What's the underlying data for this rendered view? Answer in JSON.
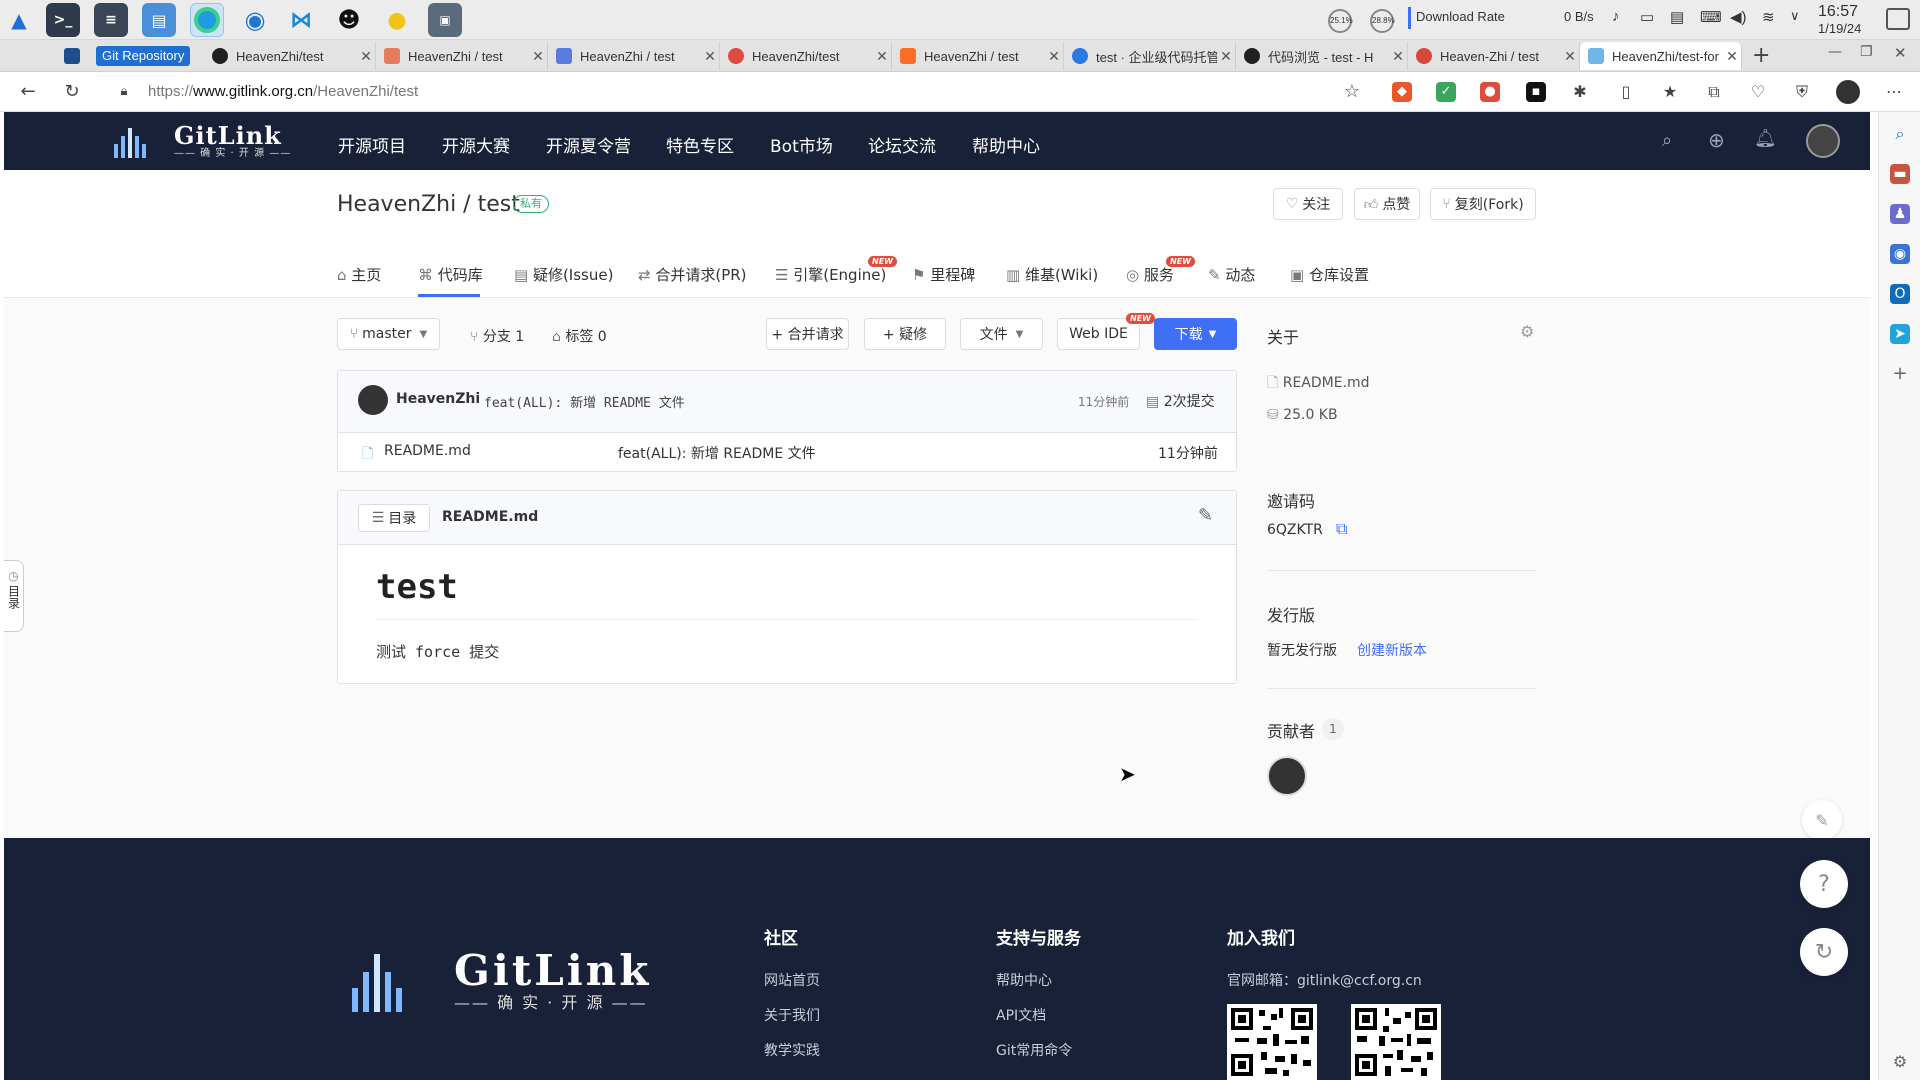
{
  "taskbar": {
    "apps": [
      "arch-logo-icon",
      "terminal-icon",
      "system-monitor-icon",
      "file-manager-icon",
      "edge-browser-icon",
      "thunderbird-icon",
      "vscode-icon",
      "qq-icon",
      "music-icon",
      "screenshot-app-icon"
    ],
    "cpu": "25.1%",
    "mem": "28.8%",
    "download_label": "Download Rate",
    "download_value": "0 B/s",
    "time": "16:57",
    "date": "1/19/24"
  },
  "browser": {
    "tabs": [
      {
        "label": "Git Repository"
      },
      {
        "label": "HeavenZhi/test"
      },
      {
        "label": "HeavenZhi / test"
      },
      {
        "label": "HeavenZhi / test"
      },
      {
        "label": "HeavenZhi/test"
      },
      {
        "label": "HeavenZhi / test"
      },
      {
        "label": "test · 企业级代码托管"
      },
      {
        "label": "代码浏览 - test - H"
      },
      {
        "label": "Heaven-Zhi / test"
      },
      {
        "label": "HeavenZhi/test-for"
      }
    ],
    "url_prefix": "https://",
    "url_host": "www.gitlink.org.cn",
    "url_path": "/HeavenZhi/test"
  },
  "site": {
    "logo_text": "GitLink",
    "logo_sub": "—— 确 实 · 开 源 ——",
    "nav": [
      "开源项目",
      "开源大赛",
      "开源夏令营",
      "特色专区",
      "Bot市场",
      "论坛交流",
      "帮助中心"
    ]
  },
  "repo": {
    "title": "HeavenZhi / test",
    "private_badge": "私有",
    "watch": "关注",
    "star": "点赞",
    "fork": "复刻(Fork)",
    "tabs": [
      "主页",
      "代码库",
      "疑修(Issue)",
      "合并请求(PR)",
      "引擎(Engine)",
      "里程碑",
      "维基(Wiki)",
      "服务",
      "动态",
      "仓库设置"
    ],
    "new_tag": "NEW",
    "branch": "master",
    "branches": "分支 1",
    "tags": "标签 0",
    "btn_pr": "+ 合并请求",
    "btn_issue": "+ 疑修",
    "btn_file": "文件",
    "btn_webide": "Web IDE",
    "btn_download": "下载"
  },
  "commit": {
    "author": "HeavenZhi",
    "message": "feat(ALL): 新增 README 文件",
    "time": "11分钟前",
    "count": "2次提交"
  },
  "files": [
    {
      "name": "README.md",
      "message": "feat(ALL): 新增 README 文件",
      "time": "11分钟前"
    }
  ],
  "readme": {
    "toc": "目录",
    "filename": "README.md",
    "heading": "test",
    "body": "测试 force 提交"
  },
  "about": {
    "title": "关于",
    "readme": "README.md",
    "size": "25.0 KB",
    "invite_title": "邀请码",
    "invite_code": "6QZKTR",
    "release_title": "发行版",
    "no_release": "暂无发行版",
    "create_release": "创建新版本",
    "contributors_title": "贡献者",
    "contributors_count": "1"
  },
  "left_toc_tab": "目录",
  "footer": {
    "logo_text": "GitLink",
    "logo_sub": "—— 确 实 · 开 源 ——",
    "col1_title": "社区",
    "col1_links": [
      "网站首页",
      "关于我们",
      "教学实践"
    ],
    "col2_title": "支持与服务",
    "col2_links": [
      "帮助中心",
      "API文档",
      "Git常用命令"
    ],
    "col3_title": "加入我们",
    "email_label": "官网邮箱：",
    "email": "gitlink@ccf.org.cn"
  },
  "colors": {
    "nav_bg": "#192139",
    "primary": "#3f6ff5",
    "private": "#2bb673",
    "new_tag": "#e24c3f"
  }
}
